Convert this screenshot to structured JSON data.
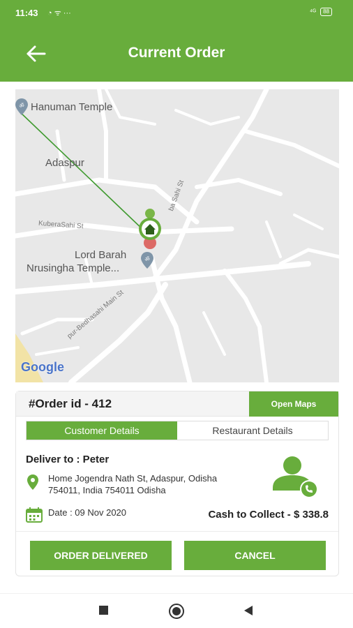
{
  "status_bar": {
    "time": "11:43",
    "icons": "◔ ᯤ ···",
    "signal": "⁴ᴳ",
    "battery": "88"
  },
  "header": {
    "title": "Current Order"
  },
  "map": {
    "labels": {
      "hanuman_temple": "Hanuman Temple",
      "adaspur": "Adaspur",
      "lord_barah_1": "Lord Barah",
      "lord_barah_2": "Nrusingha Temple...",
      "kubera_sahi": "KuberaSahi St",
      "main_st": "pur-Bedhasahi Main St",
      "sahi_st": "ba Sahi St"
    },
    "google_logo": "Google"
  },
  "order": {
    "id_label": "#Order id - 412",
    "open_maps": "Open Maps",
    "tabs": {
      "customer": "Customer Details",
      "restaurant": "Restaurant Details"
    },
    "deliver_to": "Deliver to :  Peter",
    "address_line1": "Home Jogendra Nath St, Adaspur, Odisha",
    "address_line2": "754011, India 754011 Odisha",
    "date": "Date : 09 Nov 2020",
    "cash_to_collect": "Cash to Collect - $ 338.8",
    "btn_delivered": "ORDER DELIVERED",
    "btn_cancel": "CANCEL"
  },
  "colors": {
    "primary": "#68ad3c",
    "map_bg": "#e8e8e8",
    "road": "#ffffff"
  }
}
